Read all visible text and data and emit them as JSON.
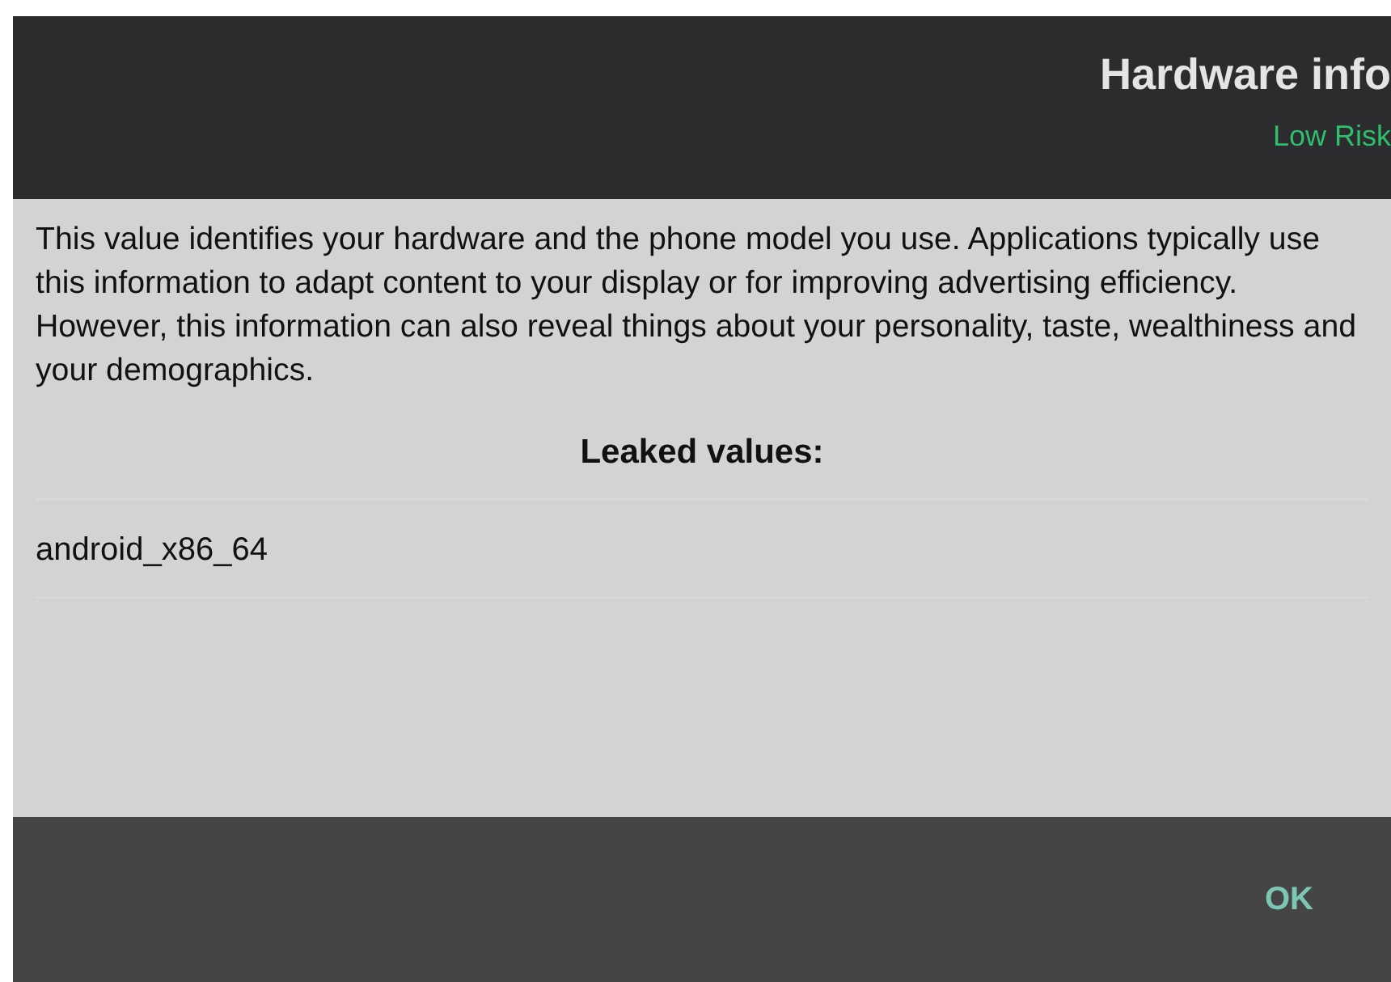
{
  "dialog": {
    "title": "Hardware info",
    "risk": "Low Risk",
    "description": "This value identifies your hardware and the phone model you use. Applications typically use this information to adapt content to your display or for improving advertising efficiency. However, this information can also reveal things about your personality, taste, wealthiness and your demographics.",
    "leaked_heading": "Leaked values:",
    "leaked_values": [
      "android_x86_64"
    ],
    "buttons": [
      "OK"
    ]
  }
}
